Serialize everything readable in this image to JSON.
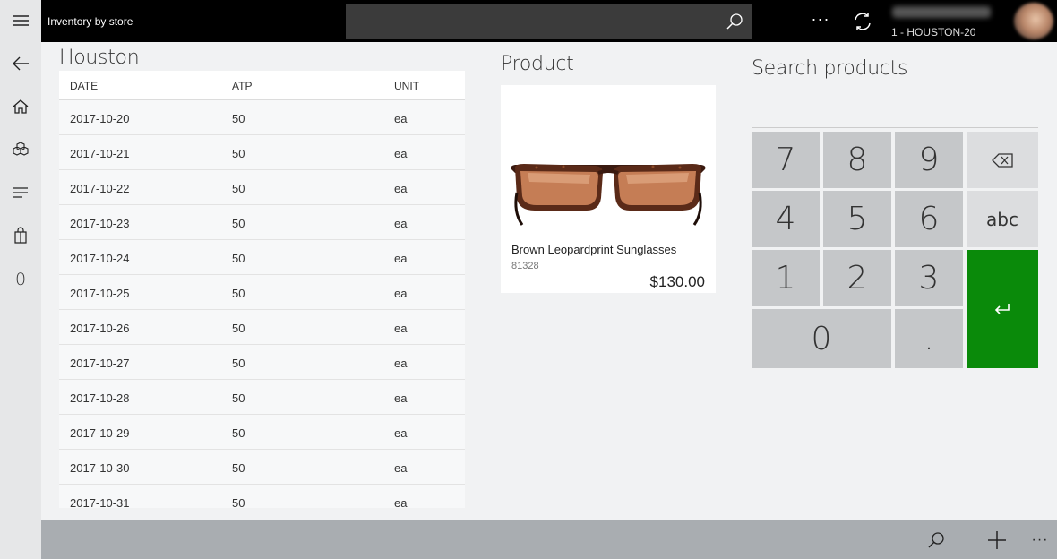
{
  "header": {
    "app_title": "Inventory by store",
    "search_placeholder": "",
    "store_label": "1 - HOUSTON-20",
    "more_label": "···"
  },
  "nav": {
    "count": "0",
    "items": [
      "menu-icon",
      "back-icon",
      "home-icon",
      "products-icon",
      "list-icon",
      "bag-icon"
    ]
  },
  "inventory": {
    "store_name": "Houston",
    "columns": [
      "DATE",
      "ATP",
      "UNIT"
    ],
    "rows": [
      [
        "2017-10-20",
        "50",
        "ea"
      ],
      [
        "2017-10-21",
        "50",
        "ea"
      ],
      [
        "2017-10-22",
        "50",
        "ea"
      ],
      [
        "2017-10-23",
        "50",
        "ea"
      ],
      [
        "2017-10-24",
        "50",
        "ea"
      ],
      [
        "2017-10-25",
        "50",
        "ea"
      ],
      [
        "2017-10-26",
        "50",
        "ea"
      ],
      [
        "2017-10-27",
        "50",
        "ea"
      ],
      [
        "2017-10-28",
        "50",
        "ea"
      ],
      [
        "2017-10-29",
        "50",
        "ea"
      ],
      [
        "2017-10-30",
        "50",
        "ea"
      ],
      [
        "2017-10-31",
        "50",
        "ea"
      ]
    ]
  },
  "product": {
    "section_title": "Product",
    "name": "Brown Leopardprint Sunglasses",
    "id": "81328",
    "price": "$130.00"
  },
  "search": {
    "title": "Search products",
    "keys": {
      "k7": "7",
      "k8": "8",
      "k9": "9",
      "k4": "4",
      "k5": "5",
      "k6": "6",
      "k1": "1",
      "k2": "2",
      "k3": "3",
      "k0": "0",
      "dot": ".",
      "abc": "abc"
    }
  },
  "appbar": {
    "more_label": "···"
  },
  "colors": {
    "enter_key": "#0a8a0a",
    "topbar": "#000000",
    "appbar": "#a9adb1"
  }
}
